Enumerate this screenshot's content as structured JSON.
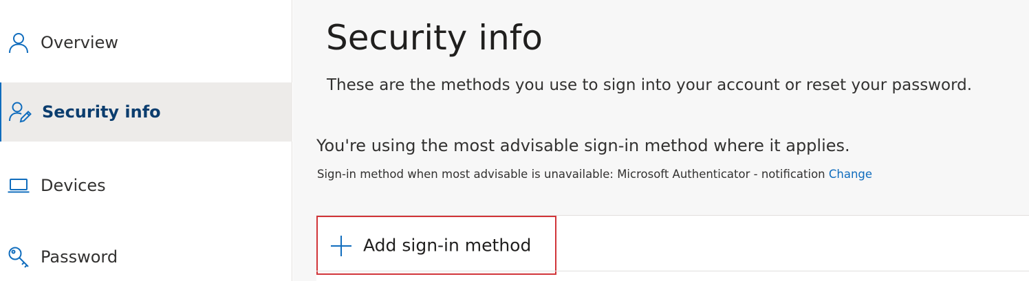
{
  "sidebar": {
    "items": [
      {
        "label": "Overview",
        "icon": "person-icon",
        "active": false
      },
      {
        "label": "Security info",
        "icon": "person-edit-icon",
        "active": true
      },
      {
        "label": "Devices",
        "icon": "laptop-icon",
        "active": false
      },
      {
        "label": "Password",
        "icon": "key-icon",
        "active": false
      }
    ]
  },
  "main": {
    "title": "Security info",
    "subtitle": "These are the methods you use to sign into your account or reset your password.",
    "advisable_heading": "You're using the most advisable sign-in method where it applies.",
    "default_method_text": "Sign-in method when most advisable is unavailable: Microsoft Authenticator - notification",
    "change_link": "Change",
    "add_method_label": "Add sign-in method",
    "add_method_icon": "plus-icon"
  },
  "colors": {
    "accent": "#0f6cbd",
    "active_text": "#0b3d6e",
    "highlight_border": "#d13438",
    "sidebar_active_bg": "#edebe9",
    "main_bg": "#f7f7f7"
  }
}
